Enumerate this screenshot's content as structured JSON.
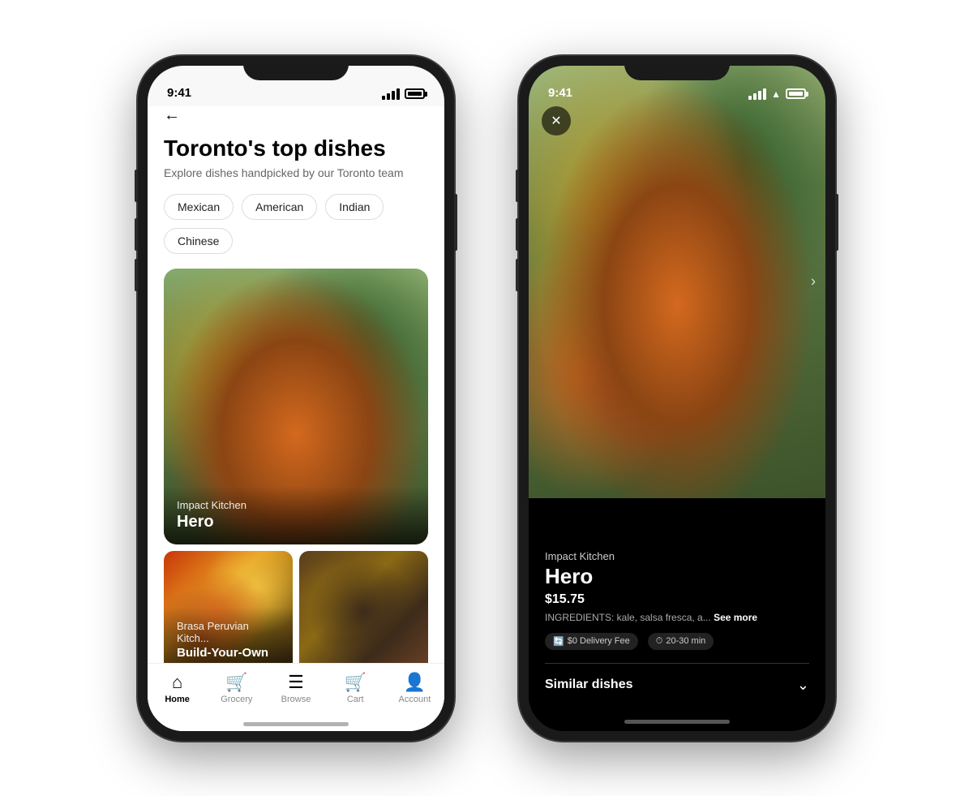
{
  "phones": {
    "left": {
      "status_time": "9:41",
      "back_label": "←",
      "page_title": "Toronto's top dishes",
      "page_subtitle": "Explore dishes handpicked by our Toronto team",
      "filters": [
        "Mexican",
        "American",
        "Indian",
        "Chinese"
      ],
      "dish_large": {
        "restaurant": "Impact Kitchen",
        "name": "Hero"
      },
      "dish_small_1": {
        "restaurant": "Brasa Peruvian Kitch...",
        "name": "Build-Your-Own"
      },
      "nav": {
        "items": [
          {
            "id": "home",
            "label": "Home",
            "active": true
          },
          {
            "id": "grocery",
            "label": "Grocery",
            "active": false
          },
          {
            "id": "browse",
            "label": "Browse",
            "active": false
          },
          {
            "id": "cart",
            "label": "Cart",
            "active": false
          },
          {
            "id": "account",
            "label": "Account",
            "active": false
          }
        ]
      }
    },
    "right": {
      "status_time": "9:41",
      "close_label": "✕",
      "restaurant": "Impact Kitchen",
      "dish_name": "Hero",
      "price": "$15.75",
      "ingredients": "INGREDIENTS: kale, salsa fresca, a...",
      "see_more": "See more",
      "delivery_fee": "$0 Delivery Fee",
      "delivery_time": "20-30 min",
      "similar_dishes": "Similar dishes",
      "next_arrow": "›"
    }
  }
}
